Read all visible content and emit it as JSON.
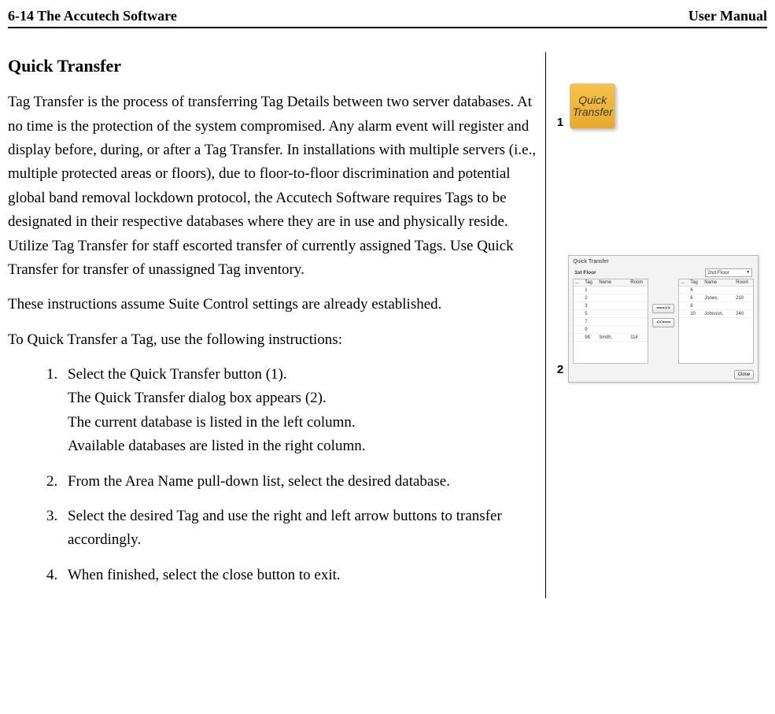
{
  "header": {
    "left": "6-14 The Accutech Software",
    "right": "User Manual"
  },
  "title": "Quick Transfer",
  "para1": "Tag Transfer is the process of transferring Tag Details between two server databases. At no time is the protection of the system compromised. Any alarm event will register and display before, during, or after a Tag Transfer. In installations with multiple servers (i.e., multiple protected areas or floors), due to floor-to-floor discrimination and potential global band removal lockdown protocol, the Accutech Software requires Tags to be designated in their respective databases where they are in use and physically reside. Utilize Tag Transfer for staff escorted transfer of currently assigned Tags. Use Quick Transfer for transfer of unassigned Tag inventory.",
  "para2": "These instructions assume Suite Control settings are already established.",
  "para3": "To Quick Transfer a Tag, use the following instructions:",
  "steps": {
    "s1a": "Select the Quick Transfer button (1).",
    "s1b": "The Quick Transfer dialog box appears (2).",
    "s1c": "The current database is listed in the left column.",
    "s1d": "Available databases are listed in the right column.",
    "s2": "From the Area Name pull-down list, select the desired database.",
    "s3": "Select the desired Tag and use the right and left arrow buttons to transfer accordingly.",
    "s4": "When finished, select the close button to exit."
  },
  "side": {
    "n1": "1",
    "n2": "2",
    "iconTop": "Quick",
    "iconBottom": "Transfer"
  },
  "dialog": {
    "title": "Quick Transfer",
    "leftHeader": "1st Floor",
    "rightSelected": "2nd Floor",
    "columns": {
      "c1": "...",
      "c2": "Tag",
      "c3": "Name",
      "c4": "Room"
    },
    "leftRows": [
      {
        "tag": "1",
        "name": "",
        "room": ""
      },
      {
        "tag": "2",
        "name": "",
        "room": ""
      },
      {
        "tag": "3",
        "name": "",
        "room": ""
      },
      {
        "tag": "5",
        "name": "",
        "room": ""
      },
      {
        "tag": "7",
        "name": "",
        "room": ""
      },
      {
        "tag": "9",
        "name": "",
        "room": ""
      },
      {
        "tag": "98",
        "name": "Smith,",
        "room": "114"
      }
    ],
    "rightRows": [
      {
        "tag": "4",
        "name": "",
        "room": ""
      },
      {
        "tag": "6",
        "name": "Jones,",
        "room": "210"
      },
      {
        "tag": "8",
        "name": "",
        "room": ""
      },
      {
        "tag": "10",
        "name": "Johnson,",
        "room": "240"
      }
    ],
    "btnRight": "===>>",
    "btnLeft": "<<===",
    "close": "Close"
  }
}
